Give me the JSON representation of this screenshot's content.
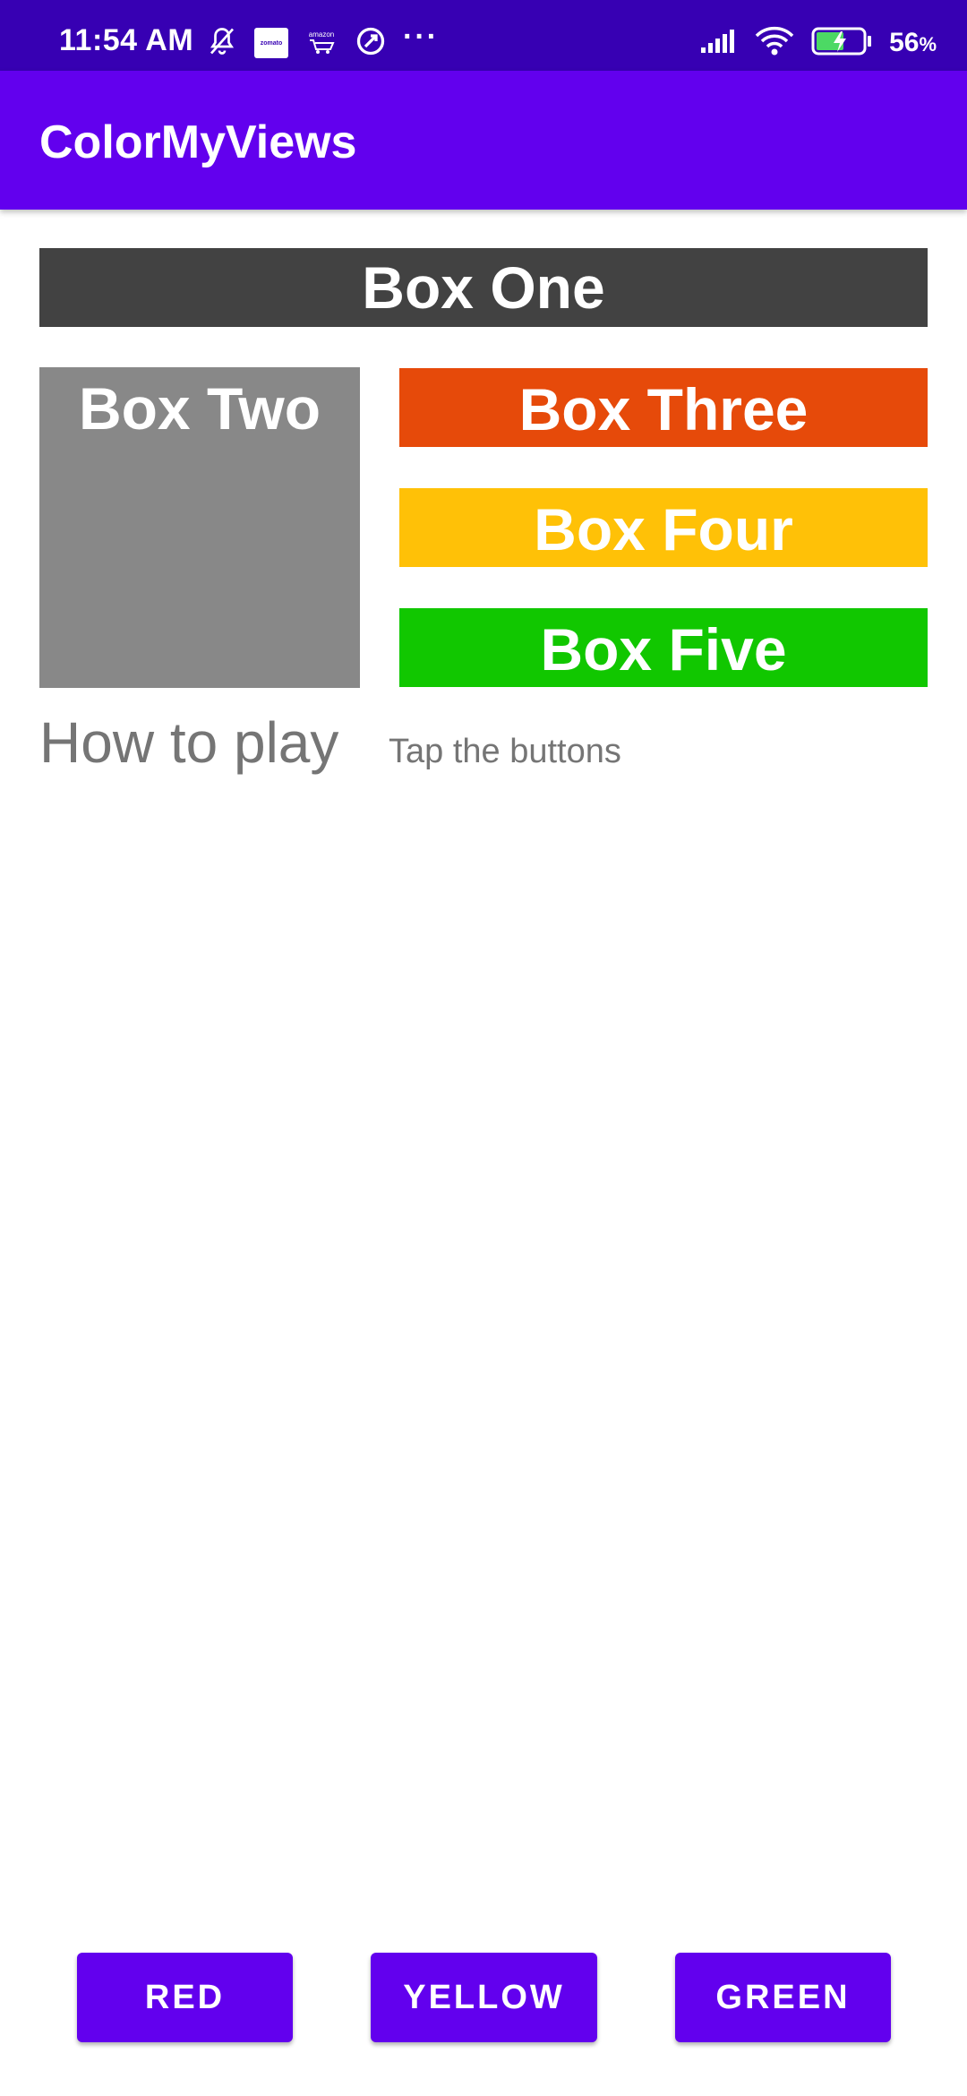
{
  "status_bar": {
    "time": "11:54 AM",
    "zomato_badge": "zomato",
    "amazon_badge": "amazon",
    "overflow_dots": "···",
    "battery_percent": "56",
    "battery_unit": "%",
    "icons": [
      "mute-bell-icon",
      "zomato-app-icon",
      "amazon-app-icon",
      "vpn-icon",
      "more-dots-icon",
      "signal-icon",
      "wifi-icon",
      "battery-charging-icon"
    ]
  },
  "app_bar": {
    "title": "ColorMyViews"
  },
  "boxes": {
    "one": {
      "label": "Box One",
      "color": "#424242"
    },
    "two": {
      "label": "Box Two",
      "color": "#888888"
    },
    "three": {
      "label": "Box Three",
      "color": "#E64A0A"
    },
    "four": {
      "label": "Box Four",
      "color": "#FFC107"
    },
    "five": {
      "label": "Box Five",
      "color": "#11C700"
    }
  },
  "instructions": {
    "heading": "How to play",
    "text": "Tap the buttons"
  },
  "buttons": {
    "red": "RED",
    "yellow": "YELLOW",
    "green": "GREEN"
  },
  "colors": {
    "status_bar": "#3700B3",
    "primary": "#6200EE"
  }
}
